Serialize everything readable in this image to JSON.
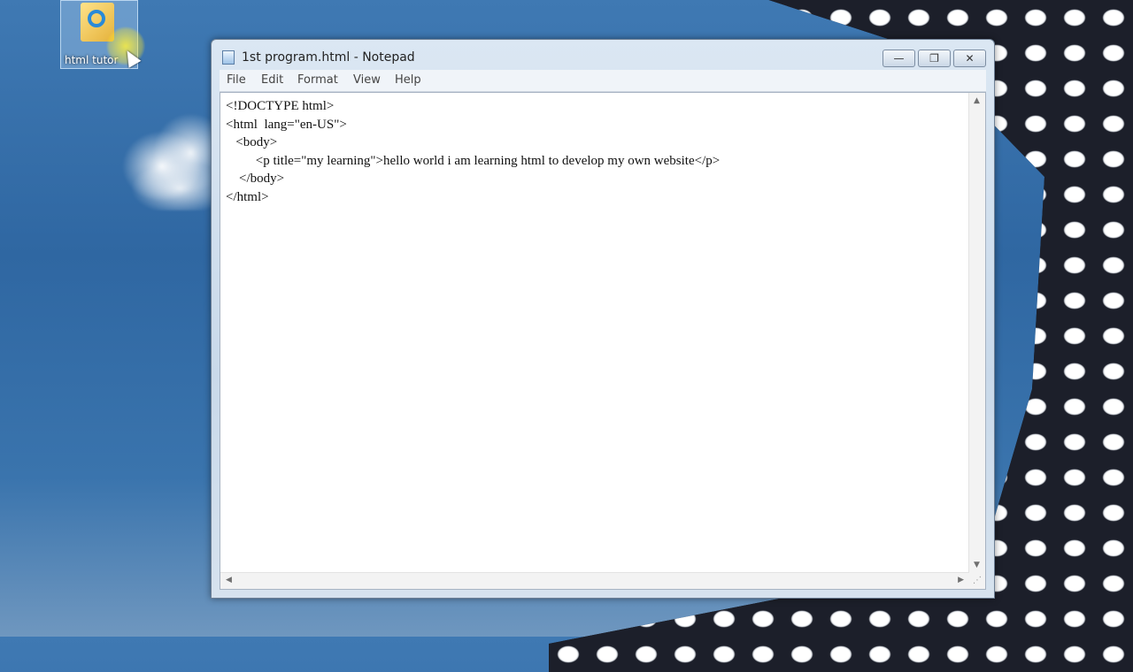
{
  "desktop": {
    "icon_label": "html tutor"
  },
  "window": {
    "title": "1st program.html - Notepad",
    "controls": {
      "minimize": "—",
      "maximize": "❐",
      "close": "✕"
    },
    "menu": [
      "File",
      "Edit",
      "Format",
      "View",
      "Help"
    ],
    "lines": [
      "<!DOCTYPE html>",
      "<html  lang=\"en-US\">",
      "   <body>",
      "         <p title=\"my learning\">hello world i am learning html to develop my own website</p>",
      "    </body>",
      "</html>"
    ]
  }
}
